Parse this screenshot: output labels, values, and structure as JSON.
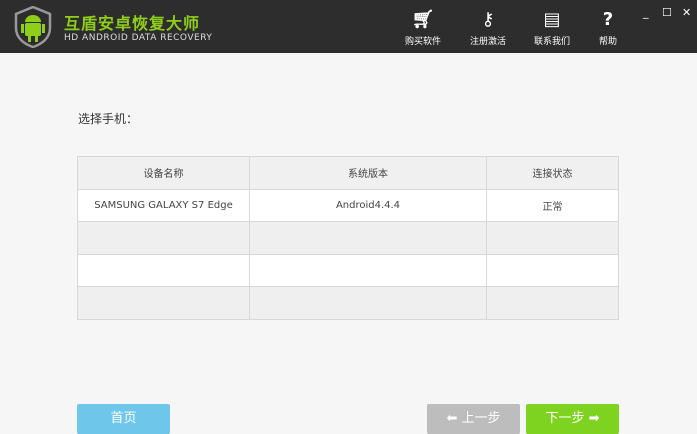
{
  "header": {
    "title": "互盾安卓恢复大师",
    "subtitle": "HD ANDROID DATA RECOVERY",
    "buttons": [
      {
        "label": "购买软件",
        "icon": "cart-icon"
      },
      {
        "label": "注册激活",
        "icon": "key-icon"
      },
      {
        "label": "联系我们",
        "icon": "chat-icon"
      },
      {
        "label": "帮助",
        "icon": "help-icon"
      }
    ]
  },
  "main": {
    "label": "选择手机：",
    "columns": [
      "设备名称",
      "系统版本",
      "连接状态"
    ],
    "rows": [
      [
        "SAMSUNG GALAXY S7 Edge",
        "Android4.4.4",
        "正常"
      ]
    ]
  },
  "footer": {
    "home": "首页",
    "prev": "上一步",
    "next": "下一步"
  },
  "colors": {
    "accent": "#8fcf1a",
    "home": "#6ec6ea",
    "prev": "#bdbdbd",
    "next": "#7ed321"
  }
}
